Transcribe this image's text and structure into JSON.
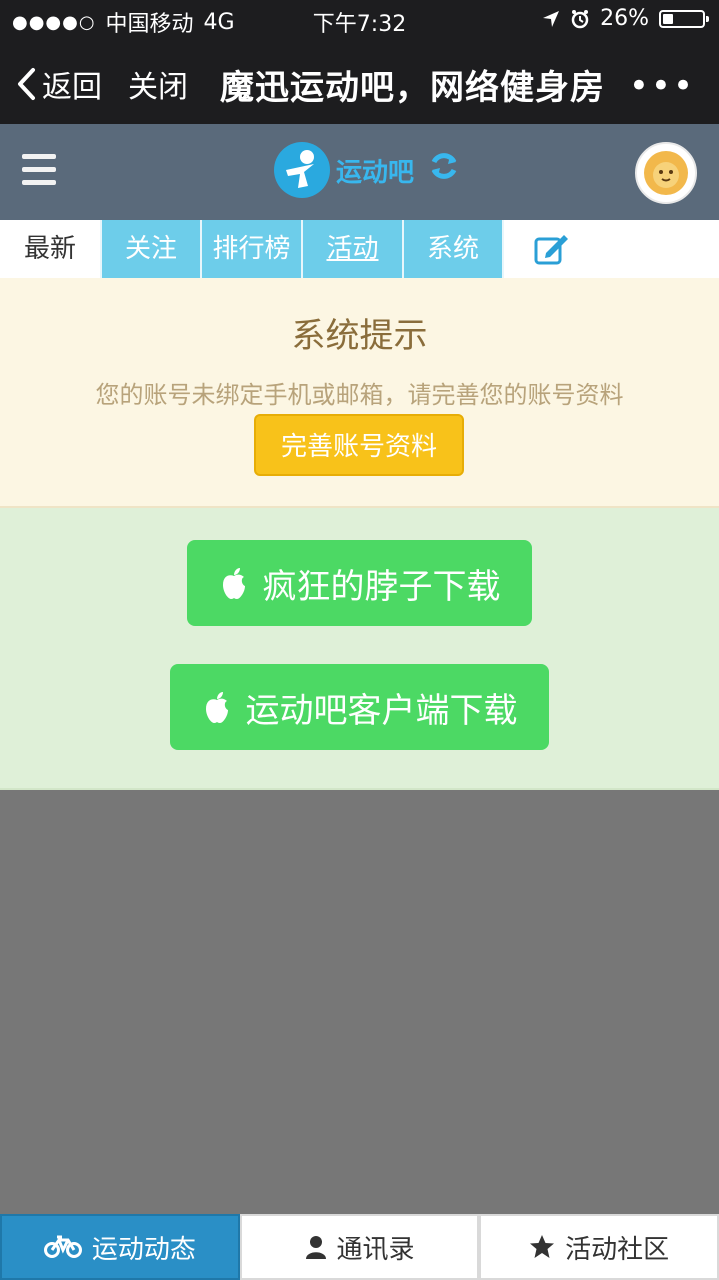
{
  "status_bar": {
    "signal": "●●●●○",
    "carrier": "中国移动",
    "network": "4G",
    "time": "下午7:32",
    "battery": "26%"
  },
  "wechat_header": {
    "back_label": "返回",
    "close_label": "关闭",
    "title": "魔迅运动吧，网络健身房",
    "more": "•••"
  },
  "app_header": {
    "logo_text": "运动吧"
  },
  "tabs": [
    {
      "label": "最新"
    },
    {
      "label": "关注"
    },
    {
      "label": "排行榜"
    },
    {
      "label": "活动"
    },
    {
      "label": "系统"
    }
  ],
  "notice": {
    "title": "系统提示",
    "message": "您的账号未绑定手机或邮箱，请完善您的账号资料",
    "button": "完善账号资料"
  },
  "downloads": [
    {
      "label": "疯狂的脖子下载"
    },
    {
      "label": "运动吧客户端下载"
    }
  ],
  "bottom_nav": [
    {
      "label": "运动动态"
    },
    {
      "label": "通讯录"
    },
    {
      "label": "活动社区"
    }
  ]
}
